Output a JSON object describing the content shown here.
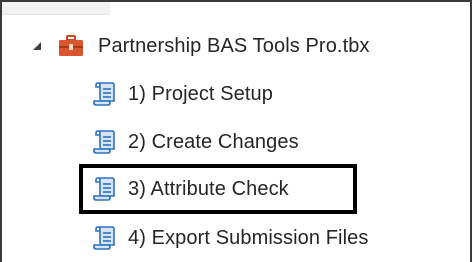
{
  "tree": {
    "toolbox": {
      "label": "Partnership BAS Tools Pro.tbx",
      "icon": "toolbox-icon",
      "expander_icon": "expanded-triangle-icon",
      "icon_color": "#d9552b"
    },
    "scripts": [
      {
        "label": "1) Project Setup",
        "icon": "python-script-icon"
      },
      {
        "label": "2) Create Changes",
        "icon": "python-script-icon"
      },
      {
        "label": "3) Attribute Check",
        "icon": "python-script-icon",
        "highlighted": true
      },
      {
        "label": "4) Export Submission Files",
        "icon": "python-script-icon"
      }
    ],
    "script_icon_color": "#2e6fbf"
  },
  "highlight_color": "#000000"
}
